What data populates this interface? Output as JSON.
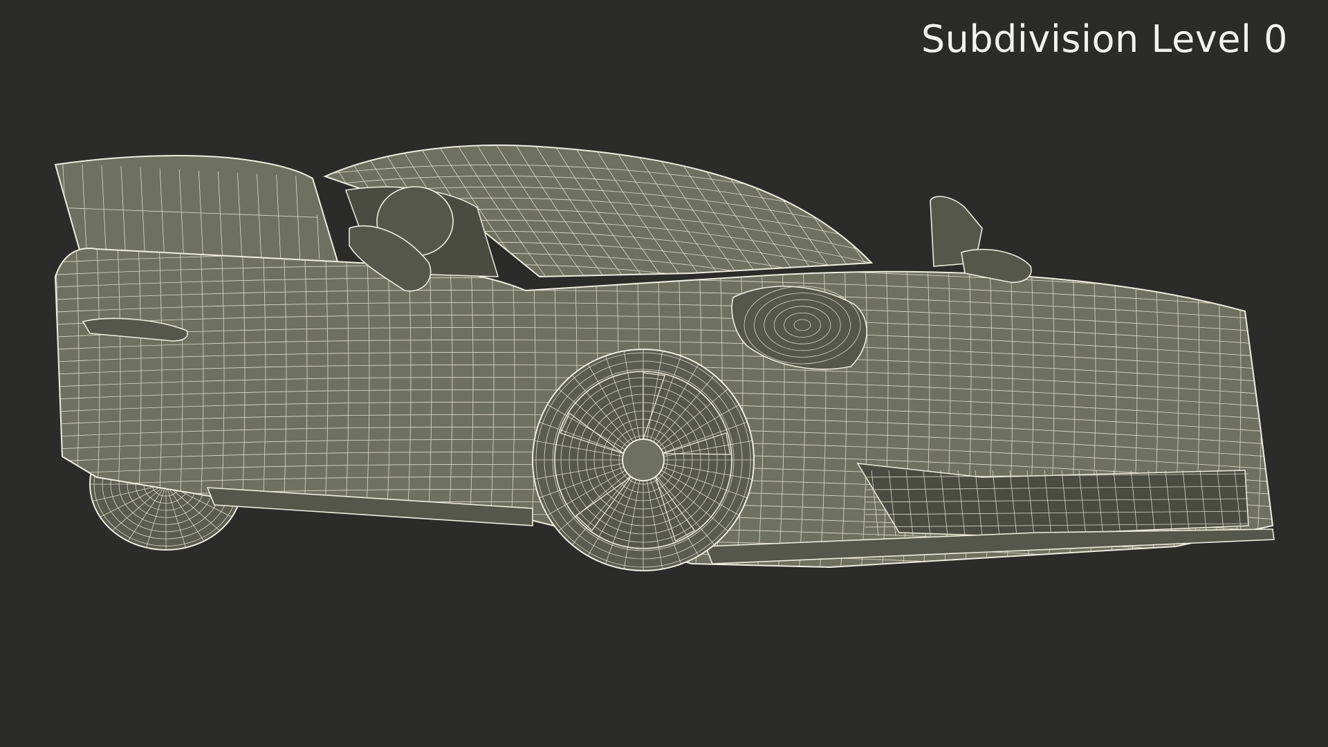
{
  "overlay": {
    "label": "Subdivision Level 0"
  },
  "scene": {
    "background_color": "#2b2b2a",
    "wire_color": "#e9e6d6",
    "surface_color": "#6f7160"
  }
}
